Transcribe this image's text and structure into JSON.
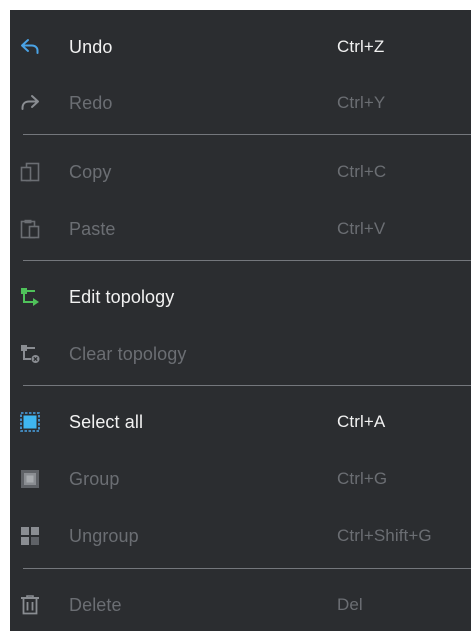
{
  "menu": {
    "items": [
      {
        "label": "Undo",
        "shortcut": "Ctrl+Z",
        "icon": "undo-icon",
        "enabled": true
      },
      {
        "label": "Redo",
        "shortcut": "Ctrl+Y",
        "icon": "redo-icon",
        "enabled": false
      },
      {
        "label": "Copy",
        "shortcut": "Ctrl+C",
        "icon": "copy-icon",
        "enabled": false
      },
      {
        "label": "Paste",
        "shortcut": "Ctrl+V",
        "icon": "paste-icon",
        "enabled": false
      },
      {
        "label": "Edit topology",
        "shortcut": "",
        "icon": "edit-topology-icon",
        "enabled": true
      },
      {
        "label": "Clear topology",
        "shortcut": "",
        "icon": "clear-topology-icon",
        "enabled": false
      },
      {
        "label": "Select all",
        "shortcut": "Ctrl+A",
        "icon": "select-all-icon",
        "enabled": true
      },
      {
        "label": "Group",
        "shortcut": "Ctrl+G",
        "icon": "group-icon",
        "enabled": false
      },
      {
        "label": "Ungroup",
        "shortcut": "Ctrl+Shift+G",
        "icon": "ungroup-icon",
        "enabled": false
      },
      {
        "label": "Delete",
        "shortcut": "Del",
        "icon": "delete-icon",
        "enabled": false
      }
    ]
  },
  "colors": {
    "menu_background": "#2b2d30",
    "enabled_text": "#f1f1f1",
    "disabled_text": "#6b6e73",
    "separator": "#74777c",
    "accent_blue": "#4aa3e6",
    "accent_green": "#4fc25a"
  }
}
